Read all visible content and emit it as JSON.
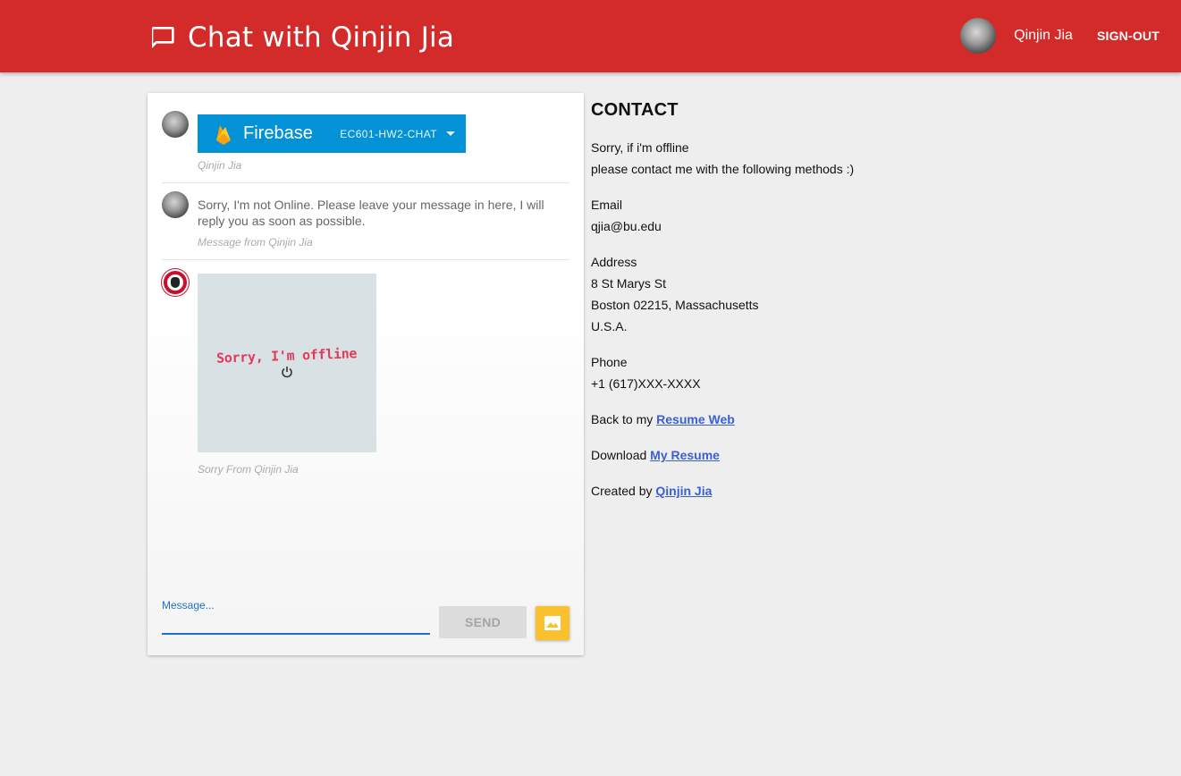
{
  "header": {
    "title": "Chat with Qinjin Jia",
    "user_name": "Qinjin Jia",
    "signout_label": "SIGN-OUT",
    "background_color": "#d32a2a"
  },
  "messages": [
    {
      "author_caption": "Qinjin Jia",
      "banner": {
        "brand": "Firebase",
        "project": "EC601-HW2-CHAT"
      }
    },
    {
      "text": "Sorry, I'm not Online. Please leave your message in here, I will reply you as soon as possible.",
      "caption": "Message from Qinjin Jia"
    },
    {
      "image_text": "Sorry, I'm offline",
      "caption": "Sorry From Qinjin Jia"
    }
  ],
  "composer": {
    "label": "Message...",
    "value": "",
    "send_label": "SEND",
    "accent_color": "#1a73c8",
    "image_button_color": "#fbc02d"
  },
  "contact": {
    "heading": "CONTACT",
    "intro_line1": "Sorry, if i'm offline",
    "intro_line2": "please contact me with the following methods :)",
    "email_label": "Email",
    "email_value": "qjia@bu.edu",
    "address_label": "Address",
    "address_line1": "8 St Marys St",
    "address_line2": "Boston 02215, Massachusetts",
    "address_line3": "U.S.A.",
    "phone_label": "Phone",
    "phone_value": "+1 (617)XXX-XXXX",
    "resume_prefix": "Back to my ",
    "resume_link": "Resume Web",
    "download_prefix": "Download ",
    "download_link": "My Resume",
    "created_prefix": "Created by ",
    "created_link": "Qinjin Jia",
    "link_color": "#3b5fd9"
  }
}
